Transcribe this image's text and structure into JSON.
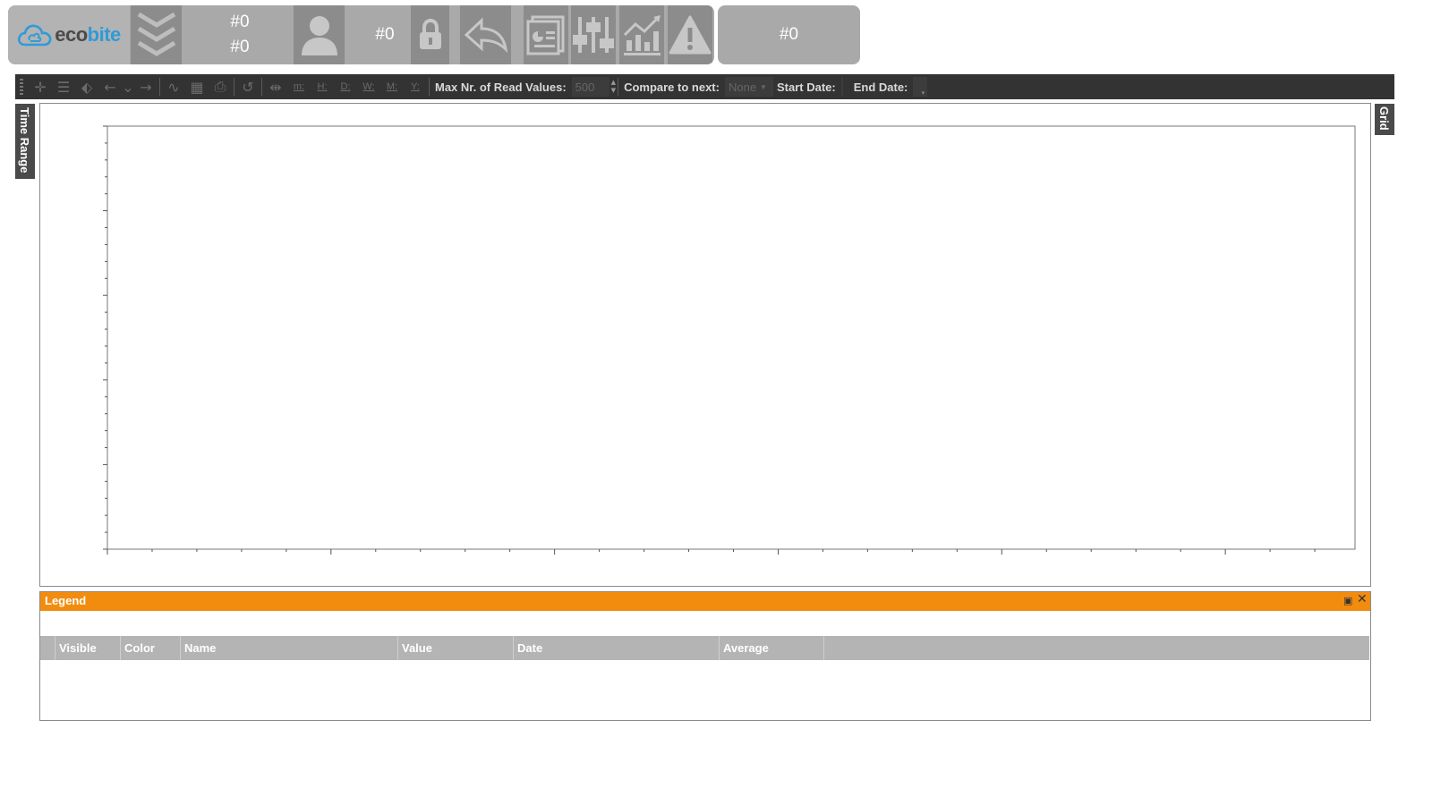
{
  "header": {
    "brand_prefix": "eco",
    "brand_suffix": "bite",
    "counter_top": "#0",
    "counter_bottom": "#0",
    "user_counter": "#0",
    "right_counter": "#0",
    "icons": [
      "cloud-icon",
      "chevrons-down-icon",
      "user-icon",
      "lock-icon",
      "back-arrow-icon",
      "report-icon",
      "sliders-icon",
      "trend-chart-icon",
      "warning-icon"
    ]
  },
  "toolbar": {
    "tools": [
      {
        "name": "crosshair-icon",
        "glyph": "✛"
      },
      {
        "name": "hline-icon",
        "glyph": "☰"
      },
      {
        "name": "tag-icon",
        "glyph": "⬖"
      },
      {
        "name": "arrow-left-icon",
        "glyph": "←"
      },
      {
        "name": "dropdown-chevron-icon",
        "glyph": "⌄"
      },
      {
        "name": "arrow-right-icon",
        "glyph": "→"
      },
      {
        "name": "pulse-icon",
        "glyph": "∿"
      },
      {
        "name": "grid-icon",
        "glyph": "▦"
      },
      {
        "name": "print-icon",
        "glyph": "⎙"
      },
      {
        "name": "reset-icon",
        "glyph": "↺"
      },
      {
        "name": "fit-icon",
        "glyph": "⇹"
      }
    ],
    "ranges": [
      "m:",
      "H:",
      "D:",
      "W:",
      "M:",
      "Y:"
    ],
    "max_values_label": "Max Nr. of Read Values:",
    "max_values_value": "500",
    "compare_label": "Compare to next:",
    "compare_value": "None",
    "start_date_label": "Start Date:",
    "end_date_label": "End Date:"
  },
  "side_tabs": {
    "time_range": "Time Range",
    "grid": "Grid"
  },
  "legend": {
    "title": "Legend",
    "pin_glyph": "📌",
    "close_glyph": "✕",
    "columns": [
      "Visible",
      "Color",
      "Name",
      "Value",
      "Date",
      "Average"
    ]
  },
  "colors": {
    "header_bg": "#a9a9a9",
    "toolbar_bg": "#333333",
    "legend_accent": "#f28c0f",
    "brand_blue": "#2f9bd8"
  }
}
